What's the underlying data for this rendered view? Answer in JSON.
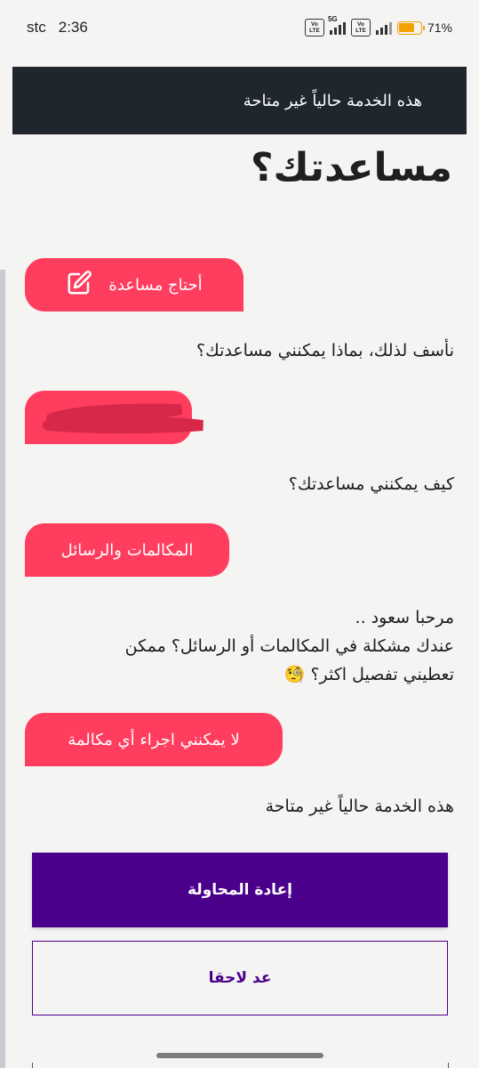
{
  "status_bar": {
    "carrier": "stc",
    "time": "2:36",
    "volte_label_top": "Vo",
    "volte_label_bottom": "LTE",
    "network": "5G",
    "battery_percent": "71%",
    "battery_level": 0.71
  },
  "toast": {
    "text": "هذه الخدمة حالياً غير متاحة"
  },
  "page": {
    "title": "مساعدتك؟"
  },
  "chat": {
    "messages": [
      {
        "from": "user",
        "text": "أحتاج مساعدة",
        "icon": "edit-icon"
      },
      {
        "from": "bot",
        "text": "نأسف لذلك، بماذا يمكنني مساعدتك؟"
      },
      {
        "from": "user",
        "text": ""
      },
      {
        "from": "bot",
        "text": "كيف يمكنني مساعدتك؟"
      },
      {
        "from": "user",
        "text": "المكالمات والرسائل"
      },
      {
        "from": "bot",
        "lines": [
          "مرحبا سعود ..",
          "عندك مشكلة في المكالمات أو الرسائل؟ ممكن",
          "تعطيني تفصيل اكثر؟ 🧐"
        ]
      },
      {
        "from": "user",
        "text": "لا يمكنني اجراء أي مكالمة"
      },
      {
        "from": "bot",
        "text": "هذه الخدمة حالياً غير متاحة"
      }
    ]
  },
  "actions": {
    "retry_label": "إعادة المحاولة",
    "later_label": "عد لاحقا"
  },
  "colors": {
    "bubble": "#ff3d5f",
    "primary": "#4b008c",
    "toast_bg": "#1f262e",
    "background": "#f4f4f2"
  }
}
